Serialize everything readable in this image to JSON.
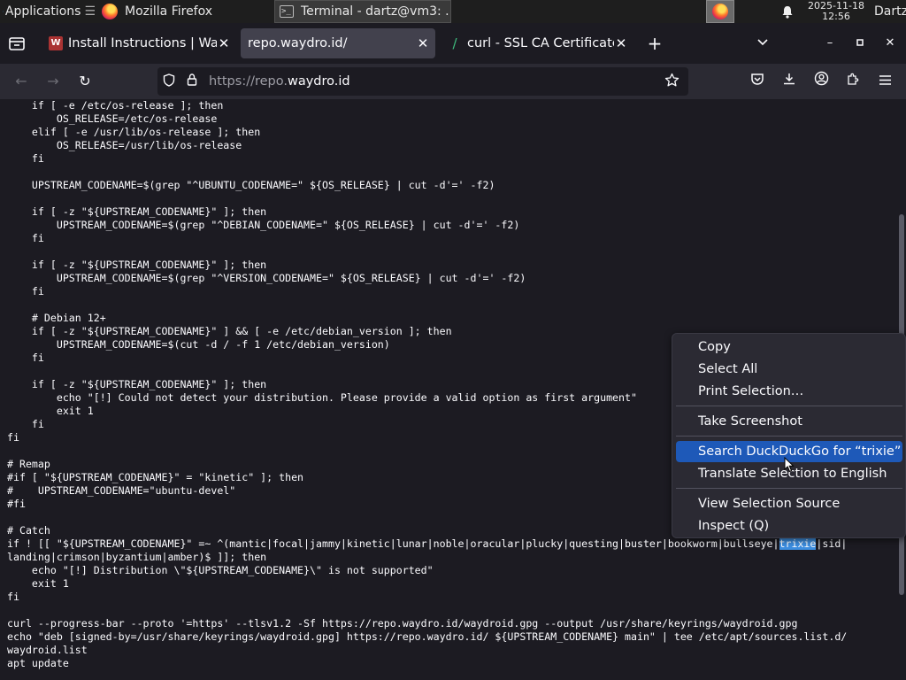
{
  "taskbar": {
    "applications_label": "Applications",
    "firefox_label": "Mozilla Firefox",
    "terminal_label": "Terminal - dartz@vm3: ...",
    "date": "2025-11-18",
    "time": "12:56",
    "user": "Dartz"
  },
  "tabs": [
    {
      "label": "Install Instructions | Waydroid",
      "favicon": "W"
    },
    {
      "label": "repo.waydro.id/"
    },
    {
      "label": "curl - SSL CA Certificates"
    }
  ],
  "urlbar": {
    "url_prefix": "https://repo.",
    "url_domain": "waydro.id"
  },
  "code": {
    "lines": [
      "    if [ -e /etc/os-release ]; then",
      "        OS_RELEASE=/etc/os-release",
      "    elif [ -e /usr/lib/os-release ]; then",
      "        OS_RELEASE=/usr/lib/os-release",
      "    fi",
      "",
      "    UPSTREAM_CODENAME=$(grep \"^UBUNTU_CODENAME=\" ${OS_RELEASE} | cut -d'=' -f2)",
      "",
      "    if [ -z \"${UPSTREAM_CODENAME}\" ]; then",
      "        UPSTREAM_CODENAME=$(grep \"^DEBIAN_CODENAME=\" ${OS_RELEASE} | cut -d'=' -f2)",
      "    fi",
      "",
      "    if [ -z \"${UPSTREAM_CODENAME}\" ]; then",
      "        UPSTREAM_CODENAME=$(grep \"^VERSION_CODENAME=\" ${OS_RELEASE} | cut -d'=' -f2)",
      "    fi",
      "",
      "    # Debian 12+",
      "    if [ -z \"${UPSTREAM_CODENAME}\" ] && [ -e /etc/debian_version ]; then",
      "        UPSTREAM_CODENAME=$(cut -d / -f 1 /etc/debian_version)",
      "    fi",
      "",
      "    if [ -z \"${UPSTREAM_CODENAME}\" ]; then",
      "        echo \"[!] Could not detect your distribution. Please provide a valid option as first argument\"",
      "        exit 1",
      "    fi",
      "fi",
      "",
      "# Remap",
      "#if [ \"${UPSTREAM_CODENAME}\" = \"kinetic\" ]; then",
      "#    UPSTREAM_CODENAME=\"ubuntu-devel\"",
      "#fi",
      "",
      "# Catch",
      "",
      "landing|crimson|byzantium|amber)$ ]]; then",
      "    echo \"[!] Distribution \\\"${UPSTREAM_CODENAME}\\\" is not supported\"",
      "    exit 1",
      "fi",
      "",
      "curl --progress-bar --proto '=https' --tlsv1.2 -Sf https://repo.waydro.id/waydroid.gpg --output /usr/share/keyrings/waydroid.gpg",
      "echo \"deb [signed-by=/usr/share/keyrings/waydroid.gpg] https://repo.waydro.id/ ${UPSTREAM_CODENAME} main\" | tee /etc/apt/sources.list.d/",
      "waydroid.list",
      "apt update"
    ],
    "catch_line_before": "if ! [[ \"${UPSTREAM_CODENAME}\" =~ ^(mantic|focal|jammy|kinetic|lunar|noble|oracular|plucky|questing|buster|bookworm|bullseye|",
    "catch_line_selected": "trixie",
    "catch_line_after": "|sid|"
  },
  "context_menu": {
    "items": [
      "Copy",
      "Select All",
      "Print Selection…",
      "Take Screenshot",
      "Search DuckDuckGo for “trixie”",
      "Translate Selection to English",
      "View Selection Source",
      "Inspect (Q)"
    ]
  }
}
